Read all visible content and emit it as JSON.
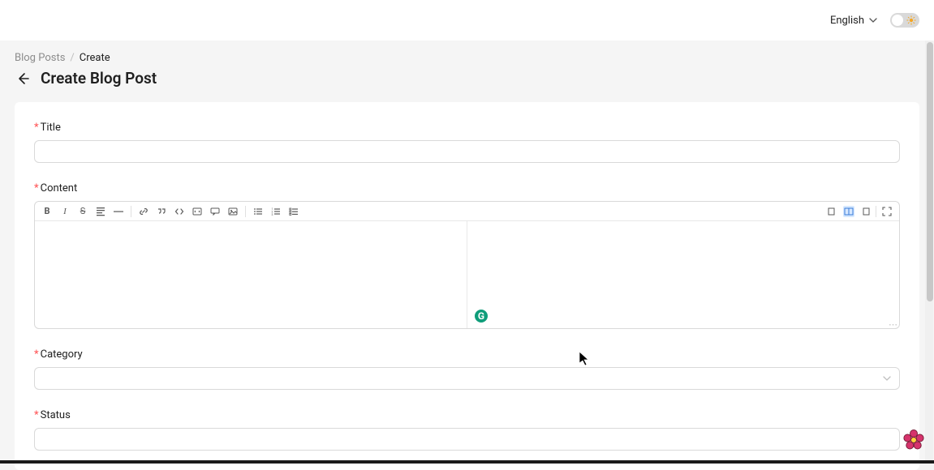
{
  "header": {
    "language_label": "English"
  },
  "breadcrumbs": {
    "item0": "Blog Posts",
    "sep": "/",
    "current": "Create"
  },
  "page": {
    "title": "Create Blog Post"
  },
  "form": {
    "title_label": "Title",
    "content_label": "Content",
    "category_label": "Category",
    "status_label": "Status"
  }
}
